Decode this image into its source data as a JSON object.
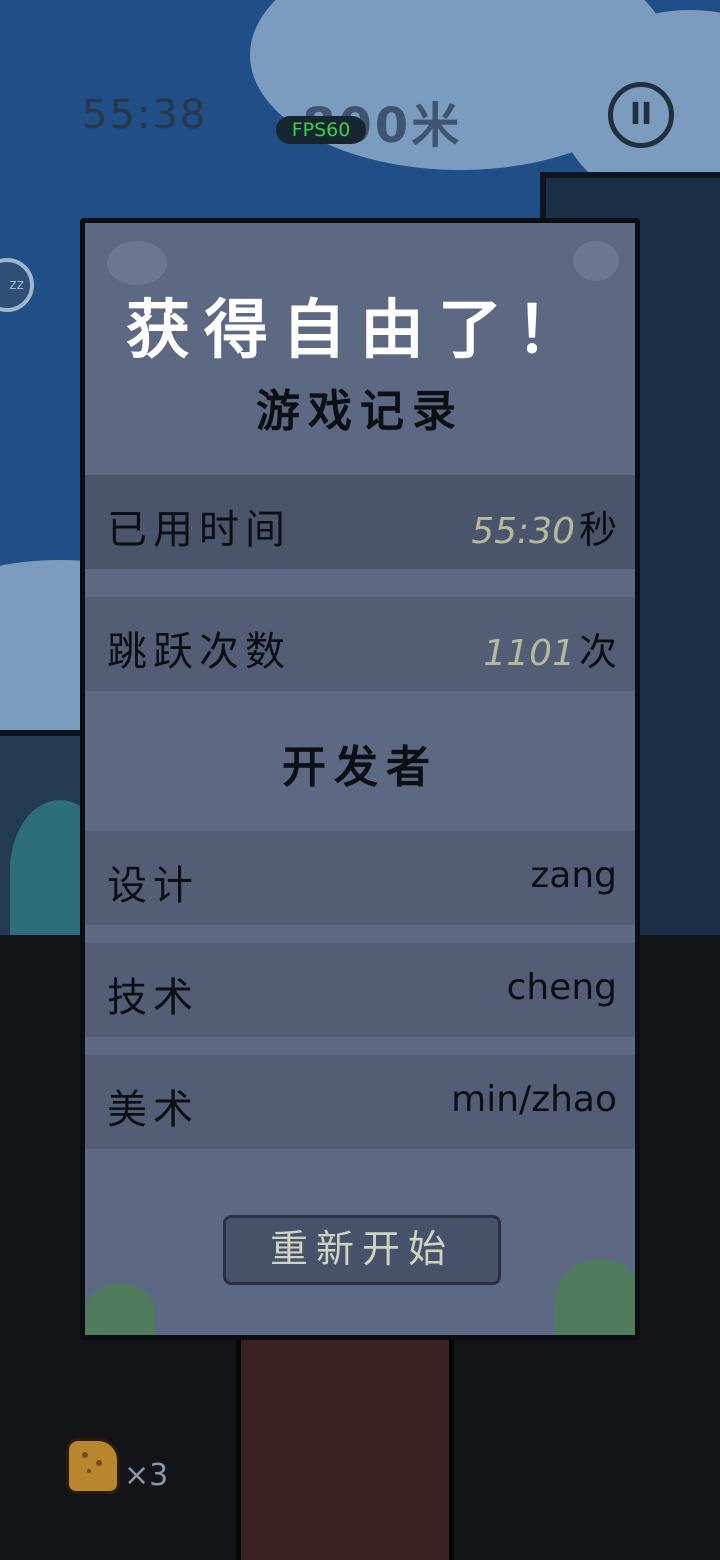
{
  "hud": {
    "timer": "55:38",
    "distance": "800米",
    "fps": "FPS60",
    "pause_glyph": "II",
    "sleep_badge": "zz"
  },
  "modal": {
    "title": "获得自由了！",
    "record_heading": "游戏记录",
    "stats": [
      {
        "label": "已用时间",
        "value": "55:30",
        "unit": "秒"
      },
      {
        "label": "跳跃次数",
        "value": "1101",
        "unit": "次"
      }
    ],
    "dev_heading": "开发者",
    "developers": [
      {
        "role": "设计",
        "name": "zang"
      },
      {
        "role": "技术",
        "name": "cheng"
      },
      {
        "role": "美术",
        "name": "min/zhao"
      }
    ],
    "restart_label": "重新开始"
  },
  "footer": {
    "lives": "×3"
  },
  "colors": {
    "panel": "#5d6982",
    "title": "#ffffff",
    "stat_number": "#b6b89c",
    "fps_text": "#3ad04c",
    "sky": "#1f4f86"
  },
  "icons": {
    "pause": "pause-icon",
    "thumb": "thumbs-up-icon"
  }
}
